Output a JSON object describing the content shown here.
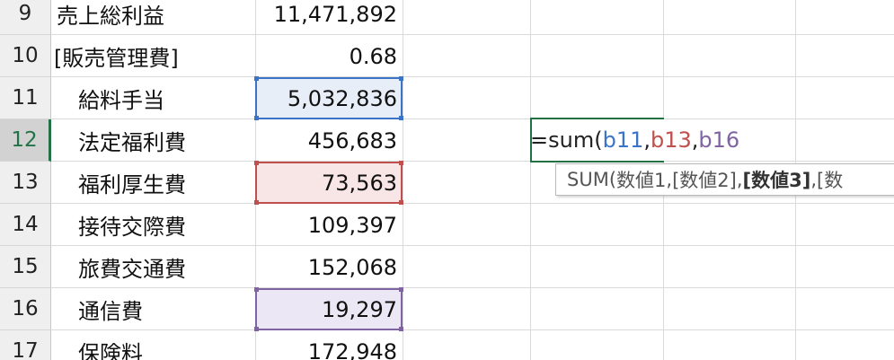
{
  "rows": [
    {
      "num": "9",
      "label": "売上総利益",
      "value": "11,471,892",
      "indent": false
    },
    {
      "num": "10",
      "label": "[販売管理費]",
      "value": "0.68",
      "indent": false
    },
    {
      "num": "11",
      "label": "給料手当",
      "value": "5,032,836",
      "indent": true
    },
    {
      "num": "12",
      "label": "法定福利費",
      "value": "456,683",
      "indent": true
    },
    {
      "num": "13",
      "label": "福利厚生費",
      "value": "73,563",
      "indent": true
    },
    {
      "num": "14",
      "label": "接待交際費",
      "value": "109,397",
      "indent": true
    },
    {
      "num": "15",
      "label": "旅費交通費",
      "value": "152,068",
      "indent": true
    },
    {
      "num": "16",
      "label": "通信費",
      "value": "19,297",
      "indent": true
    },
    {
      "num": "17",
      "label": "保険料",
      "value": "172,948",
      "indent": true
    }
  ],
  "active_row": "12",
  "formula": {
    "prefix": "=sum(",
    "ref1": "b11",
    "sep1": ",",
    "ref2": "b13",
    "sep2": ",",
    "ref3": "b16"
  },
  "tooltip": {
    "func": "SUM(",
    "arg1": "数値1",
    "sep1": ", ",
    "arg2": "[数値2]",
    "sep2": ", ",
    "arg3_bold": "[数値3]",
    "sep3": ", ",
    "more": "[数"
  },
  "colors": {
    "ref1": "#3b74c6",
    "ref1_fill": "#e7eef8",
    "ref2": "#c0504d",
    "ref2_fill": "#f8e5e5",
    "ref3": "#8064a2",
    "ref3_fill": "#ece7f4",
    "active_green": "#217346"
  }
}
